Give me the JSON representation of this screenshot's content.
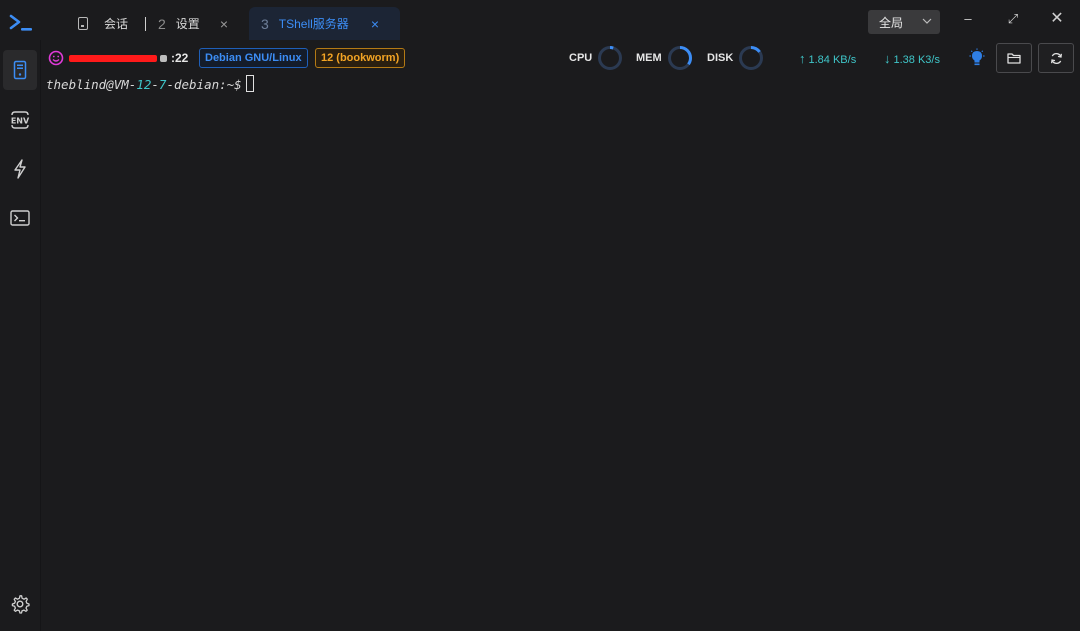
{
  "tabs": [
    {
      "label": "会话",
      "icon": "phone-icon"
    },
    {
      "number": "2",
      "label": "设置",
      "close": "×"
    },
    {
      "number": "3",
      "label": "TShell服务器",
      "close": "×"
    }
  ],
  "scope": {
    "value": "全局"
  },
  "window": {
    "minimize": "–",
    "maximize": "⤢",
    "close": "✕"
  },
  "sidebar": {
    "items": [
      {
        "name": "server-icon",
        "active": true
      },
      {
        "name": "env-icon"
      },
      {
        "name": "lightning-icon"
      },
      {
        "name": "terminal-icon"
      }
    ],
    "settings": "gear-icon"
  },
  "host": {
    "port": ":22"
  },
  "badges": {
    "os": "Debian GNU/Linux",
    "version": "12 (bookworm)"
  },
  "meters": {
    "cpu": {
      "label": "CPU",
      "level": 0.05
    },
    "mem": {
      "label": "MEM",
      "level": 0.35
    },
    "disk": {
      "label": "DISK",
      "level": 0.15
    }
  },
  "net": {
    "up": "1.84 KB/s",
    "down": "1.38 K3/s"
  },
  "terminal": {
    "prompt_user": "theblind@VM-",
    "prompt_num1": "12",
    "prompt_dash": "-",
    "prompt_num2": "7",
    "prompt_rest": "-debian:~$"
  },
  "colors": {
    "accent": "#3c8df5",
    "teal": "#3fc6c9",
    "orange": "#f3a424",
    "background": "#1b1b1d"
  }
}
